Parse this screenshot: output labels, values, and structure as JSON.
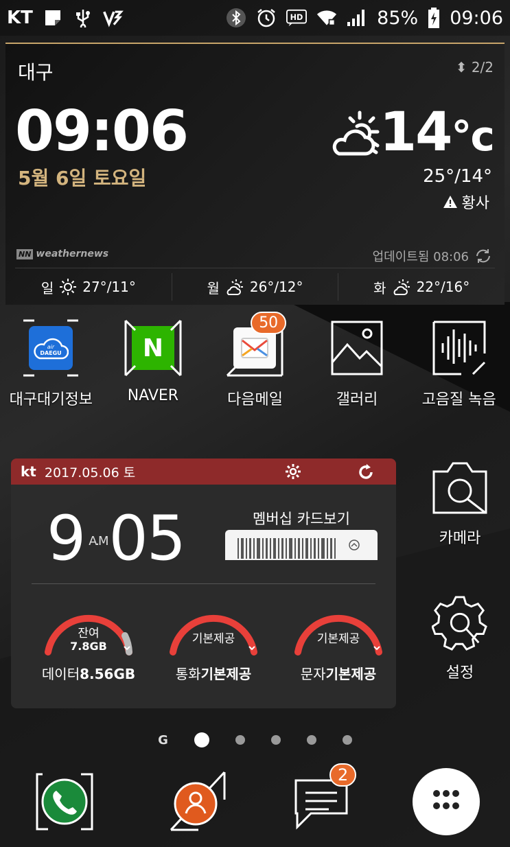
{
  "status_bar": {
    "carrier": "KT",
    "battery": "85%",
    "time": "09:06",
    "hd": "HD"
  },
  "weather": {
    "city": "대구",
    "page": "2/2",
    "time": "09:06",
    "date": "5월 6일 토요일",
    "temp": "14",
    "unit": "°c",
    "range": "25°/14°",
    "warning": "황사",
    "brand": "weathernews",
    "brand_mark": "NN",
    "updated": "업데이트됨 08:06",
    "forecast": [
      {
        "day": "일",
        "temp": "27°/11°",
        "icon": "sun-icon"
      },
      {
        "day": "월",
        "temp": "26°/12°",
        "icon": "partly-cloudy-icon"
      },
      {
        "day": "화",
        "temp": "22°/16°",
        "icon": "partly-cloudy-icon"
      }
    ]
  },
  "apps": [
    {
      "label": "대구대기정보",
      "icon_text_top": "air",
      "icon_text": "DAEGU"
    },
    {
      "label": "NAVER",
      "icon_text": "N"
    },
    {
      "label": "다음메일",
      "badge": "50"
    },
    {
      "label": "갤러리"
    },
    {
      "label": "고음질 녹음"
    }
  ],
  "kt_widget": {
    "logo": "kt",
    "date": "2017.05.06 토",
    "hour": "9",
    "ampm": "A.M",
    "minute": "05",
    "membership": "멤버십 카드보기",
    "gauges": [
      {
        "inner1": "잔여",
        "inner2": "7.8GB",
        "label_prefix": "데이터",
        "label_value": "8.56GB",
        "fill": 0.91
      },
      {
        "inner1": "기본제공",
        "label_prefix": "통화",
        "label_value": "기본제공",
        "fill": 1.0
      },
      {
        "inner1": "기본제공",
        "label_prefix": "문자",
        "label_value": "기본제공",
        "fill": 1.0
      }
    ]
  },
  "right_apps": [
    {
      "label": "카메라"
    },
    {
      "label": "설정"
    }
  ],
  "pager": {
    "home_label": "G",
    "pages": 5,
    "active": 0
  },
  "dock": {
    "messages_badge": "2"
  },
  "colors": {
    "accent_gold": "#d3b47e",
    "kt_red": "#8e2a2a",
    "badge_orange": "#e86a2a",
    "gauge_red": "#e8403a"
  }
}
